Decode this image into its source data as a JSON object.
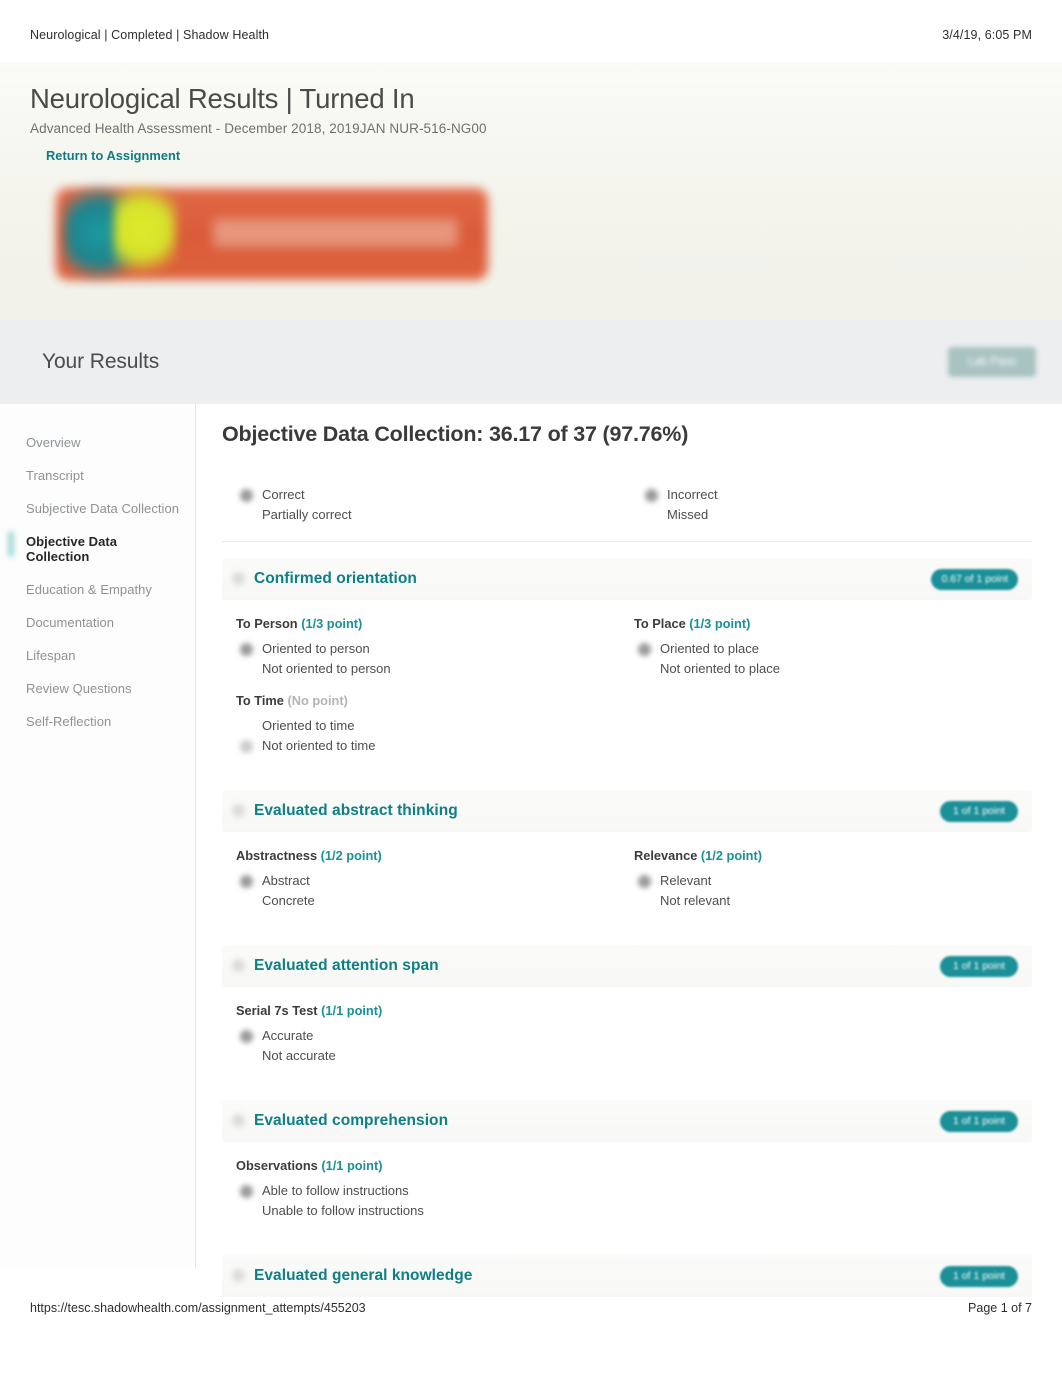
{
  "print_header": {
    "left": "Neurological | Completed | Shadow Health",
    "right": "3/4/19, 6:05 PM"
  },
  "hero": {
    "title": "Neurological Results | Turned In",
    "subtitle": "Advanced Health Assessment - December 2018, 2019JAN NUR-516-NG00",
    "return_link": "Return to Assignment",
    "logo_alt": "Shadow Health"
  },
  "results_bar": {
    "heading": "Your Results",
    "lab_pass_label": "Lab Pass"
  },
  "sidebar": {
    "items": [
      {
        "label": "Overview",
        "active": false
      },
      {
        "label": "Transcript",
        "active": false
      },
      {
        "label": "Subjective Data Collection",
        "active": false
      },
      {
        "label": "Objective Data Collection",
        "active": true
      },
      {
        "label": "Education & Empathy",
        "active": false
      },
      {
        "label": "Documentation",
        "active": false
      },
      {
        "label": "Lifespan",
        "active": false
      },
      {
        "label": "Review Questions",
        "active": false
      },
      {
        "label": "Self-Reflection",
        "active": false
      }
    ]
  },
  "main": {
    "heading": "Objective Data Collection: 36.17 of 37 (97.76%)",
    "legend": {
      "left": [
        {
          "label": "Correct",
          "marker": "filled"
        },
        {
          "label": "Partially correct",
          "marker": "blank"
        }
      ],
      "right": [
        {
          "label": "Incorrect",
          "marker": "filled"
        },
        {
          "label": "Missed",
          "marker": "blank"
        }
      ]
    },
    "sections": [
      {
        "title": "Confirmed orientation",
        "badge": "0.67 of 1 point",
        "subsections": [
          {
            "title": "To Person",
            "points": "(1/3 point)",
            "points_none": false,
            "width": "half",
            "options": [
              {
                "label": "Oriented to person",
                "marker": "filled"
              },
              {
                "label": "Not oriented to person",
                "marker": "blank"
              }
            ]
          },
          {
            "title": "To Place",
            "points": "(1/3 point)",
            "points_none": false,
            "width": "half",
            "options": [
              {
                "label": "Oriented to place",
                "marker": "filled"
              },
              {
                "label": "Not oriented to place",
                "marker": "blank"
              }
            ]
          },
          {
            "title": "To Time",
            "points": "(No point)",
            "points_none": true,
            "width": "half",
            "options": [
              {
                "label": "Oriented to time",
                "marker": "blank"
              },
              {
                "label": "Not oriented to time",
                "marker": "light"
              }
            ]
          }
        ]
      },
      {
        "title": "Evaluated abstract thinking",
        "badge": "1 of 1 point",
        "subsections": [
          {
            "title": "Abstractness",
            "points": "(1/2 point)",
            "points_none": false,
            "width": "half",
            "options": [
              {
                "label": "Abstract",
                "marker": "filled"
              },
              {
                "label": "Concrete",
                "marker": "blank"
              }
            ]
          },
          {
            "title": "Relevance",
            "points": "(1/2 point)",
            "points_none": false,
            "width": "half",
            "options": [
              {
                "label": "Relevant",
                "marker": "filled"
              },
              {
                "label": "Not relevant",
                "marker": "blank"
              }
            ]
          }
        ]
      },
      {
        "title": "Evaluated attention span",
        "badge": "1 of 1 point",
        "subsections": [
          {
            "title": "Serial 7s Test",
            "points": "(1/1 point)",
            "points_none": false,
            "width": "half",
            "options": [
              {
                "label": "Accurate",
                "marker": "filled"
              },
              {
                "label": "Not accurate",
                "marker": "blank"
              }
            ]
          }
        ]
      },
      {
        "title": "Evaluated comprehension",
        "badge": "1 of 1 point",
        "subsections": [
          {
            "title": "Observations",
            "points": "(1/1 point)",
            "points_none": false,
            "width": "half",
            "options": [
              {
                "label": "Able to follow instructions",
                "marker": "filled"
              },
              {
                "label": "Unable to follow instructions",
                "marker": "blank"
              }
            ]
          }
        ]
      },
      {
        "title": "Evaluated general knowledge",
        "badge": "1 of 1 point",
        "subsections": []
      }
    ]
  },
  "print_footer": {
    "left": "https://tesc.shadowhealth.com/assignment_attempts/455203",
    "right": "Page 1 of 7"
  },
  "colors": {
    "teal": "#1b9098",
    "teal_text": "#0e7f85",
    "logo_orange": "#d9502c",
    "logo_yellow": "#d6e32c",
    "logo_teal": "#20838d",
    "results_bar_bg": "#eceef0"
  }
}
